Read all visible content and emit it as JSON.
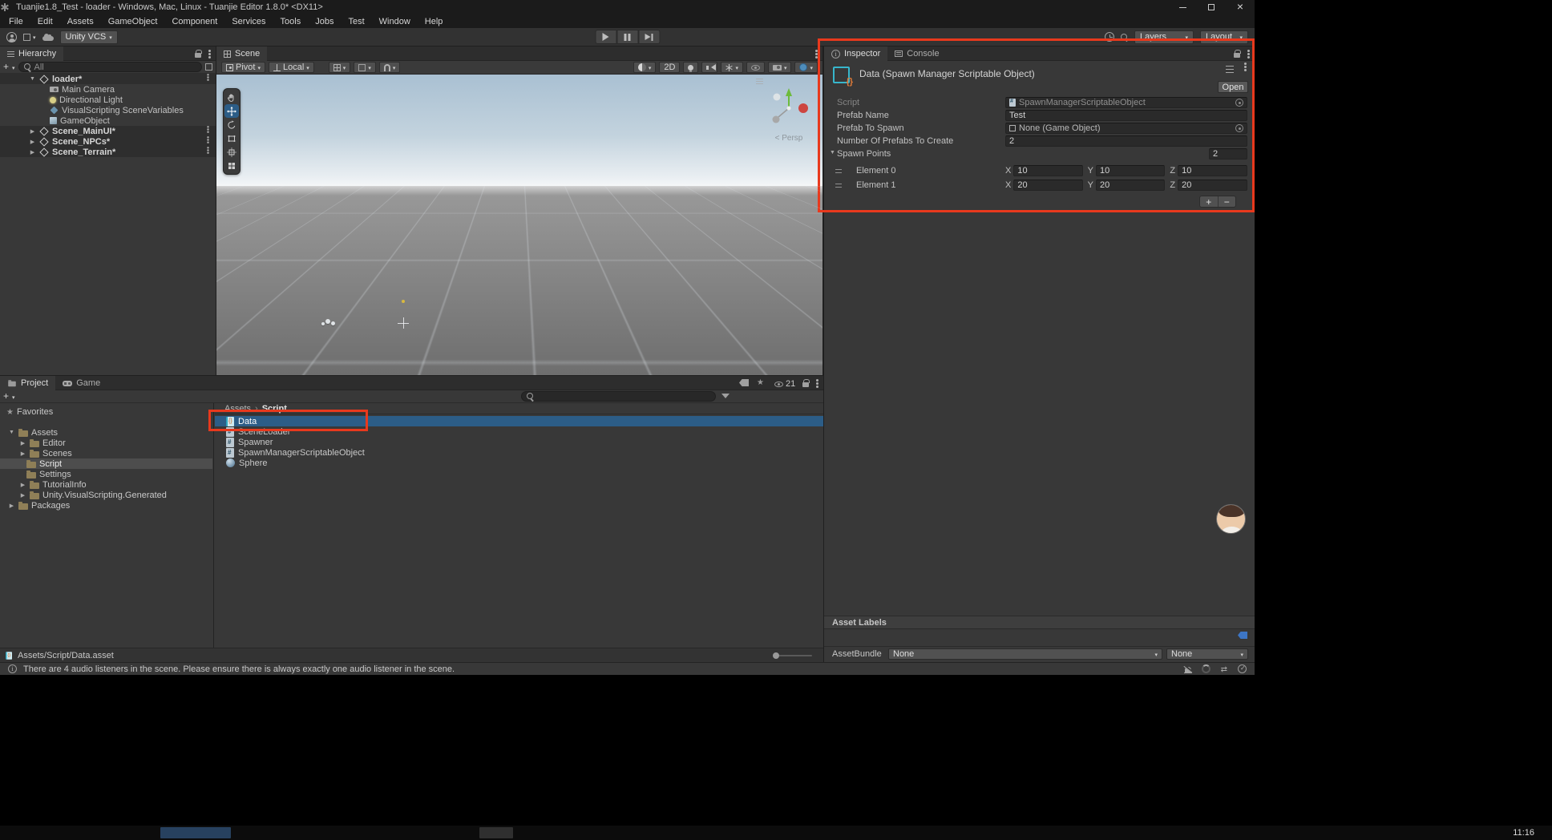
{
  "colors": {
    "selection": "#2c5d87",
    "annotation": "#e8391d",
    "tag": "#3d76c6"
  },
  "titlebar": {
    "title": "Tuanjie1.8_Test - loader - Windows, Mac, Linux - Tuanjie Editor 1.8.0* <DX11>"
  },
  "menubar": {
    "items": [
      "File",
      "Edit",
      "Assets",
      "GameObject",
      "Component",
      "Services",
      "Tools",
      "Jobs",
      "Test",
      "Window",
      "Help"
    ]
  },
  "toolbar": {
    "vcs": "Unity VCS",
    "layers": "Layers",
    "layout": "Layout"
  },
  "hierarchy": {
    "tab": "Hierarchy",
    "search_text": "All",
    "root": "loader*",
    "children": [
      "Main Camera",
      "Directional Light",
      "VisualScripting SceneVariables",
      "GameObject"
    ],
    "scenes": [
      "Scene_MainUI*",
      "Scene_NPCs*",
      "Scene_Terrain*"
    ]
  },
  "scene": {
    "tab": "Scene",
    "pivot": "Pivot",
    "local": "Local",
    "two_d": "2D",
    "persp": "< Persp"
  },
  "inspector": {
    "tabs": {
      "inspector": "Inspector",
      "console": "Console"
    },
    "header": {
      "title": "Data (Spawn Manager Scriptable Object)",
      "open": "Open"
    },
    "script_label": "Script",
    "script_value": "SpawnManagerScriptableObject",
    "prefab_name_label": "Prefab Name",
    "prefab_name_value": "Test",
    "prefab_to_spawn_label": "Prefab To Spawn",
    "prefab_to_spawn_value": "None (Game Object)",
    "count_label": "Number Of Prefabs To Create",
    "count_value": "2",
    "spawn_points": {
      "label": "Spawn Points",
      "size": "2",
      "axis": {
        "x": "X",
        "y": "Y",
        "z": "Z"
      },
      "elements": [
        {
          "name": "Element 0",
          "x": "10",
          "y": "10",
          "z": "10"
        },
        {
          "name": "Element 1",
          "x": "20",
          "y": "20",
          "z": "20"
        }
      ]
    },
    "add": "+",
    "remove": "−",
    "asset_labels": "Asset Labels",
    "assetbundle": {
      "label": "AssetBundle",
      "bundle": "None",
      "variant": "None"
    }
  },
  "project": {
    "tabs": {
      "project": "Project",
      "game": "Game"
    },
    "favorites": "Favorites",
    "tree": {
      "assets": "Assets",
      "assets_children": [
        "Editor",
        "Scenes",
        "Script",
        "Settings",
        "TutorialInfo",
        "Unity.VisualScripting.Generated"
      ],
      "packages": "Packages"
    },
    "breadcrumb": {
      "root": "Assets",
      "separator": "›",
      "current": "Script"
    },
    "files": [
      {
        "name": "Data"
      },
      {
        "name": "SceneLoader"
      },
      {
        "name": "Spawner"
      },
      {
        "name": "SpawnManagerScriptableObject"
      },
      {
        "name": "Sphere"
      }
    ],
    "footer_path": "Assets/Script/Data.asset",
    "hidden_count": "21"
  },
  "statusbar": {
    "message": "There are 4 audio listeners in the scene. Please ensure there is always exactly one audio listener in the scene."
  },
  "taskbar": {
    "clock": "11:16"
  },
  "icons": {
    "caret": "▾",
    "fold_open": "▼",
    "fold_closed": "▶",
    "kebab": "⋮",
    "breadcrumb_separator": "›"
  }
}
